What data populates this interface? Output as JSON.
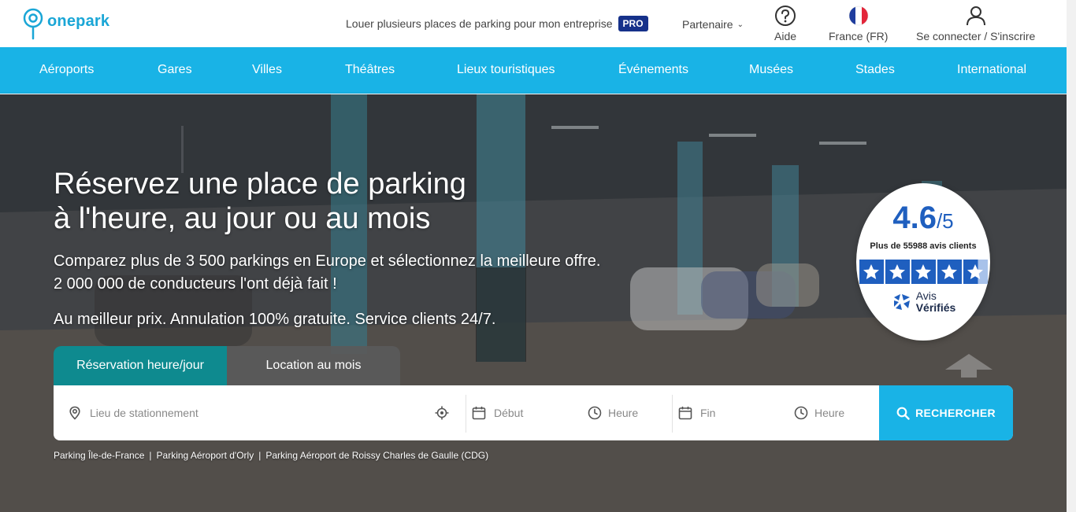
{
  "header": {
    "logo_text": "onepark",
    "pro_link_label": "Louer plusieurs places de parking pour mon entreprise",
    "pro_badge": "PRO",
    "partner_label": "Partenaire",
    "help_label": "Aide",
    "country_label": "France (FR)",
    "login_label": "Se connecter / S'inscrire"
  },
  "nav": {
    "items": [
      "Aéroports",
      "Gares",
      "Villes",
      "Théâtres",
      "Lieux touristiques",
      "Événements",
      "Musées",
      "Stades",
      "International"
    ]
  },
  "hero": {
    "title_line1": "Réservez une place de parking",
    "title_line2": "à l'heure, au jour ou au mois",
    "subtitle_line1": "Comparez plus de 3 500 parkings en Europe et sélectionnez la meilleure offre.",
    "subtitle_line2": "2 000 000 de conducteurs l'ont déjà fait !",
    "subtitle_line3": "Au meilleur prix. Annulation 100% gratuite. Service clients 24/7."
  },
  "booking": {
    "tabs": [
      "Réservation heure/jour",
      "Location au mois"
    ],
    "active_tab": 0,
    "location_placeholder": "Lieu de stationnement",
    "start_placeholder": "Début",
    "start_time_placeholder": "Heure",
    "end_placeholder": "Fin",
    "end_time_placeholder": "Heure",
    "search_button": "RECHERCHER"
  },
  "quick_links": [
    "Parking Île-de-France",
    "Parking Aéroport d'Orly",
    "Parking Aéroport de Roissy Charles de Gaulle (CDG)"
  ],
  "rating": {
    "score": "4.6",
    "scale": "/5",
    "count_label": "Plus de 55988 avis clients",
    "stars_value": 4.6,
    "brand_line1": "Avis",
    "brand_line2": "Vérifiés"
  },
  "colors": {
    "brand_blue": "#19b3e6",
    "tab_active": "#0e8a8f",
    "pro_badge": "#16318a",
    "rating_blue": "#1f5fbf"
  }
}
